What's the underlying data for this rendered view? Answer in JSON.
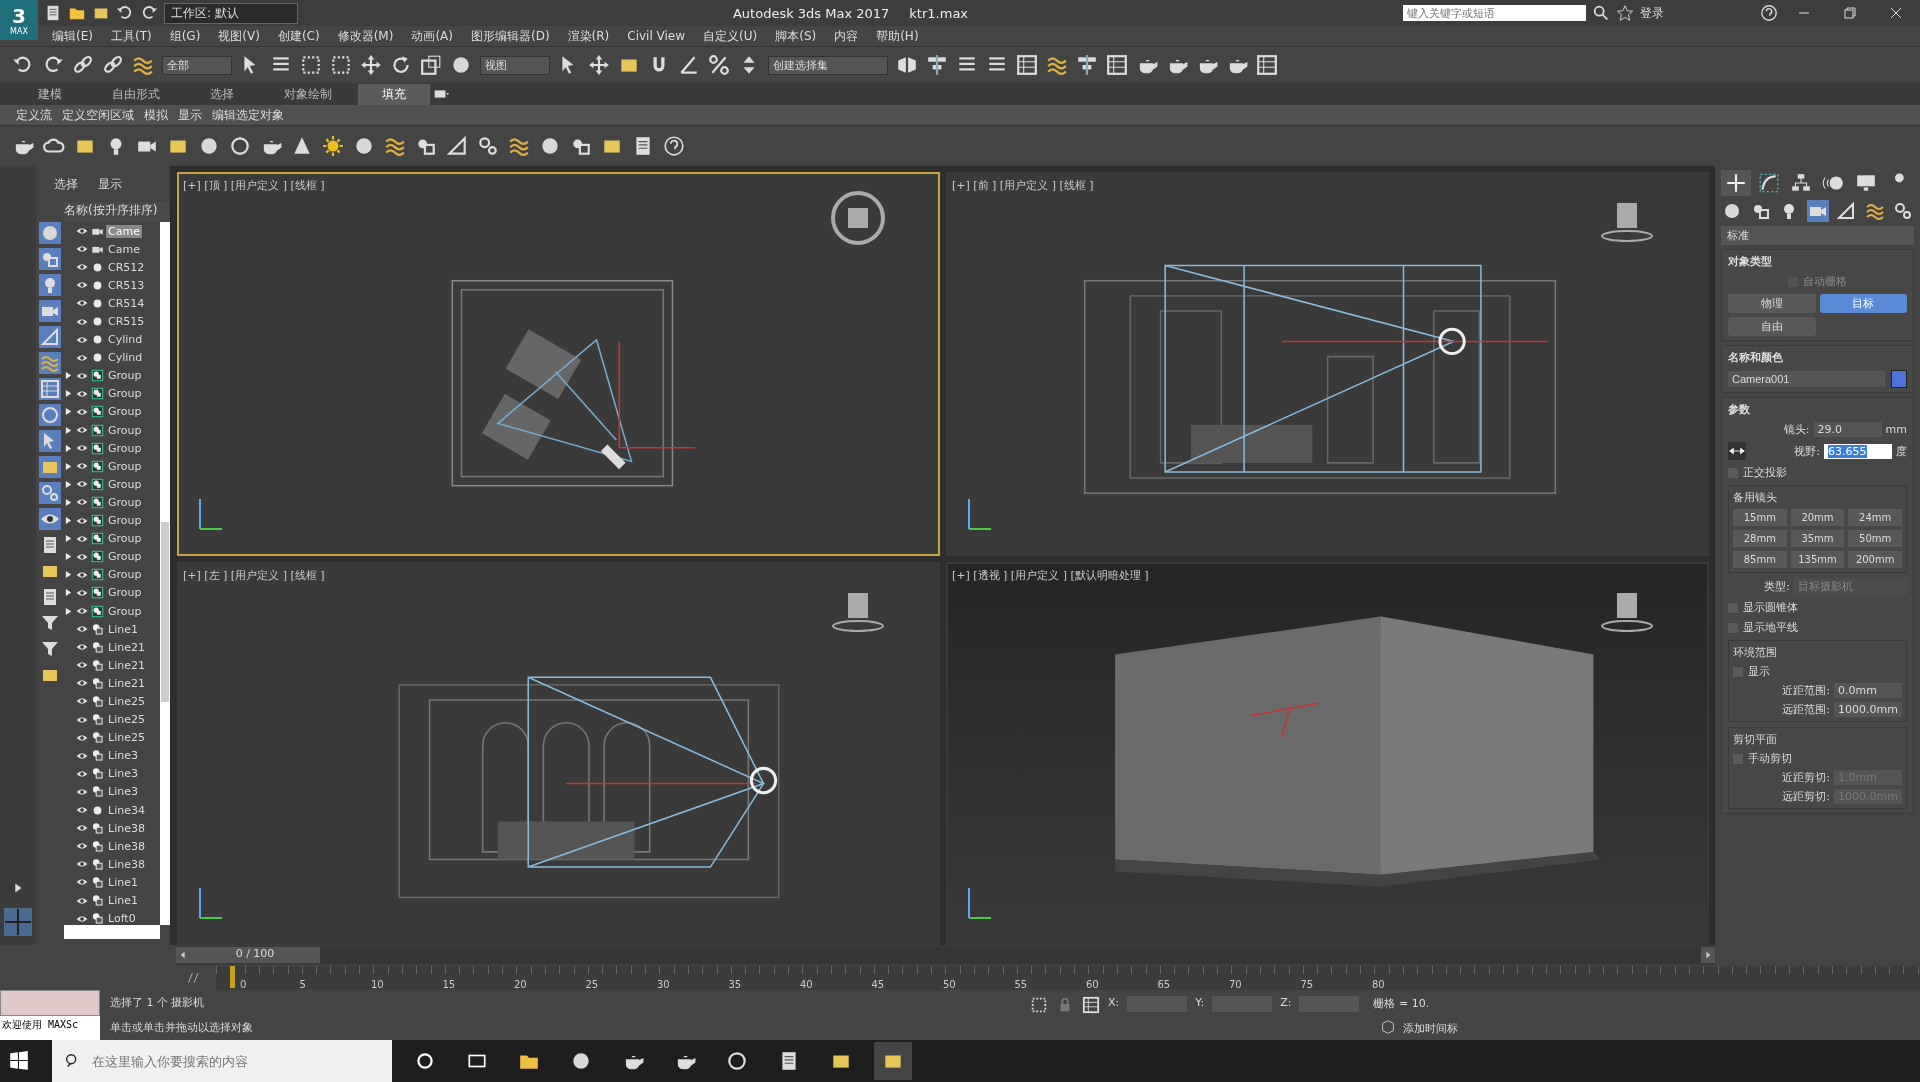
{
  "title_bar": {
    "logo_number": "3",
    "logo_text": "MAX",
    "workspace": "工作区: 默认",
    "title": "Autodesk 3ds Max 2017",
    "file": "ktr1.max",
    "search_placeholder": "键入关键字或短语",
    "login": "登录"
  },
  "menu": [
    "编辑(E)",
    "工具(T)",
    "组(G)",
    "视图(V)",
    "创建(C)",
    "修改器(M)",
    "动画(A)",
    "图形编辑器(D)",
    "渲染(R)",
    "Civil View",
    "自定义(U)",
    "脚本(S)",
    "内容",
    "帮助(H)"
  ],
  "main_toolbar": {
    "selection_filter": "全部",
    "reference_coord": "视图",
    "named_selection": "创建选择集"
  },
  "ribbon_tabs": [
    {
      "label": "建模",
      "selected": false
    },
    {
      "label": "自由形式",
      "selected": false
    },
    {
      "label": "选择",
      "selected": false
    },
    {
      "label": "对象绘制",
      "selected": false
    },
    {
      "label": "填充",
      "selected": true
    }
  ],
  "ribbon_subtabs": [
    "定义流",
    "定义空闲区域",
    "模拟",
    "显示",
    "编辑选定对象"
  ],
  "scene_explorer": {
    "tabs": [
      "选择",
      "显示"
    ],
    "column_header": "名称(按升序排序)",
    "items": [
      {
        "kind": "camera",
        "label": "Came",
        "selected": true,
        "expandable": false
      },
      {
        "kind": "camera",
        "label": "Came",
        "selected": false,
        "expandable": false
      },
      {
        "kind": "sphere",
        "label": "CR512",
        "selected": false,
        "expandable": false
      },
      {
        "kind": "sphere",
        "label": "CR513",
        "selected": false,
        "expandable": false
      },
      {
        "kind": "sphere",
        "label": "CR514",
        "selected": false,
        "expandable": false
      },
      {
        "kind": "sphere",
        "label": "CR515",
        "selected": false,
        "expandable": false
      },
      {
        "kind": "sphere",
        "label": "Cylind",
        "selected": false,
        "expandable": false
      },
      {
        "kind": "sphere",
        "label": "Cylind",
        "selected": false,
        "expandable": false
      },
      {
        "kind": "group",
        "label": "Group",
        "selected": false,
        "expandable": true
      },
      {
        "kind": "group",
        "label": "Group",
        "selected": false,
        "expandable": true
      },
      {
        "kind": "group",
        "label": "Group",
        "selected": false,
        "expandable": true
      },
      {
        "kind": "group",
        "label": "Group",
        "selected": false,
        "expandable": true
      },
      {
        "kind": "group",
        "label": "Group",
        "selected": false,
        "expandable": true
      },
      {
        "kind": "group",
        "label": "Group",
        "selected": false,
        "expandable": true
      },
      {
        "kind": "group",
        "label": "Group",
        "selected": false,
        "expandable": true
      },
      {
        "kind": "group",
        "label": "Group",
        "selected": false,
        "expandable": true
      },
      {
        "kind": "group",
        "label": "Group",
        "selected": false,
        "expandable": true
      },
      {
        "kind": "group",
        "label": "Group",
        "selected": false,
        "expandable": true
      },
      {
        "kind": "group",
        "label": "Group",
        "selected": false,
        "expandable": true
      },
      {
        "kind": "group",
        "label": "Group",
        "selected": false,
        "expandable": true
      },
      {
        "kind": "group",
        "label": "Group",
        "selected": false,
        "expandable": true
      },
      {
        "kind": "group",
        "label": "Group",
        "selected": false,
        "expandable": true
      },
      {
        "kind": "shape",
        "label": "Line1",
        "selected": false,
        "expandable": false
      },
      {
        "kind": "shape",
        "label": "Line21",
        "selected": false,
        "expandable": false
      },
      {
        "kind": "shape",
        "label": "Line21",
        "selected": false,
        "expandable": false
      },
      {
        "kind": "shape",
        "label": "Line21",
        "selected": false,
        "expandable": false
      },
      {
        "kind": "shape",
        "label": "Line25",
        "selected": false,
        "expandable": false
      },
      {
        "kind": "shape",
        "label": "Line25",
        "selected": false,
        "expandable": false
      },
      {
        "kind": "shape",
        "label": "Line25",
        "selected": false,
        "expandable": false
      },
      {
        "kind": "shape",
        "label": "Line3",
        "selected": false,
        "expandable": false
      },
      {
        "kind": "shape",
        "label": "Line3",
        "selected": false,
        "expandable": false
      },
      {
        "kind": "shape",
        "label": "Line3",
        "selected": false,
        "expandable": false
      },
      {
        "kind": "sphere",
        "label": "Line34",
        "selected": false,
        "expandable": false
      },
      {
        "kind": "shape",
        "label": "Line38",
        "selected": false,
        "expandable": false
      },
      {
        "kind": "shape",
        "label": "Line38",
        "selected": false,
        "expandable": false
      },
      {
        "kind": "shape",
        "label": "Line38",
        "selected": false,
        "expandable": false
      },
      {
        "kind": "shape",
        "label": "Line1",
        "selected": false,
        "expandable": false
      },
      {
        "kind": "shape",
        "label": "Line1",
        "selected": false,
        "expandable": false
      },
      {
        "kind": "shape",
        "label": "Loft0",
        "selected": false,
        "expandable": false
      }
    ]
  },
  "viewports": [
    {
      "kind": "top",
      "label": "[+] [顶 ] [用户定义 ] [线框 ]",
      "selected": true
    },
    {
      "kind": "front",
      "label": "[+] [前 ] [用户定义 ] [线框 ]",
      "selected": false
    },
    {
      "kind": "left",
      "label": "[+] [左 ] [用户定义 ] [线框 ]",
      "selected": false
    },
    {
      "kind": "perspective",
      "label": "[+] [透视 ] [用户定义 ] [默认明暗处理 ]",
      "selected": false
    }
  ],
  "command_panel": {
    "category_dropdown": "标准",
    "object_type": {
      "title": "对象类型",
      "auto_grid": {
        "label": "自动栅格",
        "checked": false
      },
      "buttons": [
        {
          "label": "物理",
          "selected": false
        },
        {
          "label": "目标",
          "selected": true
        },
        {
          "label": "自由",
          "selected": false
        }
      ]
    },
    "name_color": {
      "title": "名称和颜色",
      "name": "Camera001",
      "color": "#4f72d9"
    },
    "parameters": {
      "title": "参数",
      "lens_label": "镜头:",
      "lens": "29.0",
      "lens_unit": "mm",
      "fov_label": "视野:",
      "fov": "63.655",
      "fov_unit": "度",
      "ortho": {
        "label": "正交投影",
        "checked": false
      },
      "stock_lenses_title": "备用镜头",
      "stock_lenses": [
        "15mm",
        "20mm",
        "24mm",
        "28mm",
        "35mm",
        "50mm",
        "85mm",
        "135mm",
        "200mm"
      ],
      "type_label": "类型:",
      "type": "目标摄影机",
      "show_cone": {
        "label": "显示圆锥体",
        "checked": false
      },
      "show_horizon": {
        "label": "显示地平线",
        "checked": false
      },
      "env_title": "环境范围",
      "env_show": {
        "label": "显示",
        "checked": false
      },
      "near_range_label": "近距范围:",
      "near_range": "0.0mm",
      "far_range_label": "远距范围:",
      "far_range": "1000.0mm",
      "clip_title": "剪切平面",
      "clip_manual": {
        "label": "手动剪切",
        "checked": false
      },
      "near_clip_label": "近距剪切:",
      "near_clip": "1.0mm",
      "far_clip_label": "远距剪切:",
      "far_clip": "1000.0mm"
    }
  },
  "timeline": {
    "frame": "0 / 100",
    "level": 0,
    "ticks": [
      "0",
      "5",
      "10",
      "15",
      "20",
      "25",
      "30",
      "35",
      "40",
      "45",
      "50",
      "55",
      "60",
      "65",
      "70",
      "75",
      "80"
    ]
  },
  "status_bar": {
    "maxscript": "欢迎使用 MAXSc",
    "selection": "选择了 1 个 摄影机",
    "prompt": "单击或单击并拖动以选择对象",
    "x_label": "X:",
    "y_label": "Y:",
    "z_label": "Z:",
    "grid": "栅格 = 10.",
    "add_time_tag": "添加时间标"
  },
  "taskbar": {
    "search_placeholder": "在这里输入你要搜索的内容"
  }
}
